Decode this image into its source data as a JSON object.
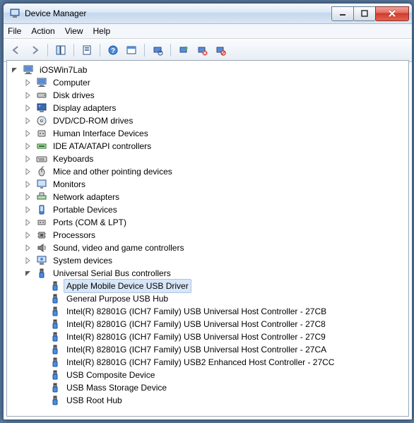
{
  "titlebar": {
    "title": "Device Manager"
  },
  "menubar": {
    "file": "File",
    "action": "Action",
    "view": "View",
    "help": "Help"
  },
  "toolbar": {
    "back": "back",
    "forward": "forward",
    "show_hide": "show-hide-console-tree",
    "properties": "properties",
    "help": "help",
    "action_btn": "action",
    "scan": "scan-hardware",
    "update": "update-driver",
    "uninstall": "uninstall",
    "disable": "disable"
  },
  "tree": {
    "root": {
      "label": "iOSWin7Lab",
      "icon": "computer"
    },
    "categories": [
      {
        "label": "Computer",
        "icon": "computer"
      },
      {
        "label": "Disk drives",
        "icon": "disk"
      },
      {
        "label": "Display adapters",
        "icon": "display"
      },
      {
        "label": "DVD/CD-ROM drives",
        "icon": "cdrom"
      },
      {
        "label": "Human Interface Devices",
        "icon": "hid"
      },
      {
        "label": "IDE ATA/ATAPI controllers",
        "icon": "ide"
      },
      {
        "label": "Keyboards",
        "icon": "keyboard"
      },
      {
        "label": "Mice and other pointing devices",
        "icon": "mouse"
      },
      {
        "label": "Monitors",
        "icon": "monitor"
      },
      {
        "label": "Network adapters",
        "icon": "network"
      },
      {
        "label": "Portable Devices",
        "icon": "portable"
      },
      {
        "label": "Ports (COM & LPT)",
        "icon": "ports"
      },
      {
        "label": "Processors",
        "icon": "cpu"
      },
      {
        "label": "Sound, video and game controllers",
        "icon": "sound"
      },
      {
        "label": "System devices",
        "icon": "system"
      }
    ],
    "usb_category": {
      "label": "Universal Serial Bus controllers",
      "icon": "usb"
    },
    "usb_children": [
      {
        "label": "Apple Mobile Device USB Driver",
        "icon": "usb",
        "selected": true
      },
      {
        "label": "General Purpose USB Hub",
        "icon": "usb"
      },
      {
        "label": "Intel(R) 82801G (ICH7 Family) USB Universal Host Controller - 27CB",
        "icon": "usb"
      },
      {
        "label": "Intel(R) 82801G (ICH7 Family) USB Universal Host Controller - 27C8",
        "icon": "usb"
      },
      {
        "label": "Intel(R) 82801G (ICH7 Family) USB Universal Host Controller - 27C9",
        "icon": "usb"
      },
      {
        "label": "Intel(R) 82801G (ICH7 Family) USB Universal Host Controller - 27CA",
        "icon": "usb"
      },
      {
        "label": "Intel(R) 82801G (ICH7 Family) USB2 Enhanced Host Controller - 27CC",
        "icon": "usb"
      },
      {
        "label": "USB Composite Device",
        "icon": "usb"
      },
      {
        "label": "USB Mass Storage Device",
        "icon": "usb"
      },
      {
        "label": "USB Root Hub",
        "icon": "usb"
      }
    ]
  }
}
